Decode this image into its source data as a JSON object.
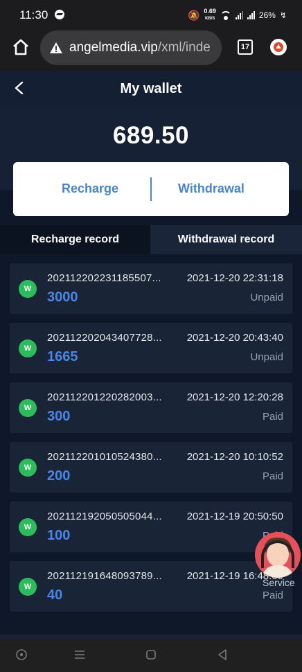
{
  "status_bar": {
    "time": "11:30",
    "speed_value": "0.69",
    "speed_unit": "KB/S",
    "battery": "26%"
  },
  "browser": {
    "url_host": "angelmedia.vip",
    "url_path": "/xml/inde",
    "tab_count": "17"
  },
  "header": {
    "title": "My wallet"
  },
  "wallet": {
    "balance": "689.50",
    "recharge_label": "Recharge",
    "withdrawal_label": "Withdrawal"
  },
  "tabs": [
    {
      "label": "Recharge record",
      "active": true
    },
    {
      "label": "Withdrawal record",
      "active": false
    }
  ],
  "records": [
    {
      "icon": "W",
      "id": "202112202231185507...",
      "datetime": "2021-12-20 22:31:18",
      "amount": "3000",
      "status": "Unpaid"
    },
    {
      "icon": "W",
      "id": "202112202043407728...",
      "datetime": "2021-12-20 20:43:40",
      "amount": "1665",
      "status": "Unpaid"
    },
    {
      "icon": "W",
      "id": "202112201220282003...",
      "datetime": "2021-12-20 12:20:28",
      "amount": "300",
      "status": "Paid"
    },
    {
      "icon": "W",
      "id": "202112201010524380...",
      "datetime": "2021-12-20 10:10:52",
      "amount": "200",
      "status": "Paid"
    },
    {
      "icon": "W",
      "id": "202112192050505044...",
      "datetime": "2021-12-19 20:50:50",
      "amount": "100",
      "status": "Paid"
    },
    {
      "icon": "W",
      "id": "202112191648093789...",
      "datetime": "2021-12-19 16:48:09",
      "amount": "40",
      "status": "Paid"
    }
  ],
  "service": {
    "label": "Service"
  },
  "colors": {
    "background": "#0f1828",
    "accent_blue": "#4a86e8",
    "icon_green": "#2dbb5b",
    "service_red": "#e6505a"
  },
  "icons": {
    "home": "home-icon",
    "warning": "warning-icon",
    "tabs": "tabs-icon",
    "update": "update-icon",
    "back": "back-arrow-icon",
    "nav_circle": "nav-home-icon",
    "nav_menu": "nav-recents-icon",
    "nav_square": "nav-overview-icon",
    "nav_back": "nav-back-icon"
  }
}
